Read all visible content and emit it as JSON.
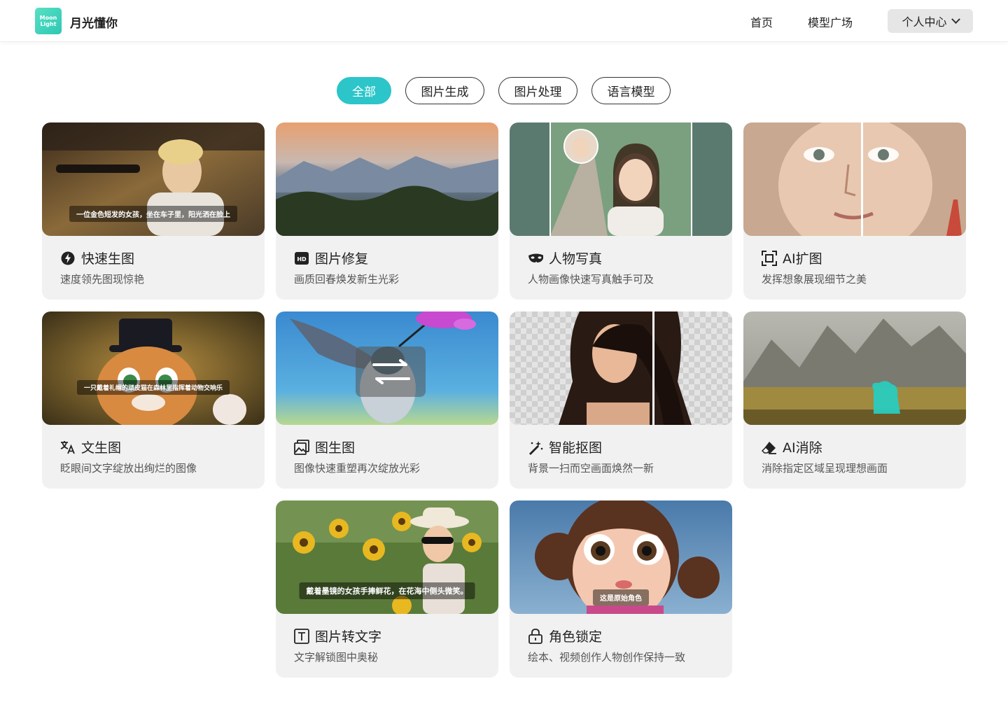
{
  "header": {
    "logo_line1": "Moon",
    "logo_line2": "Light",
    "brand": "月光懂你",
    "nav": [
      "首页",
      "模型广场"
    ],
    "user_menu": "个人中心"
  },
  "filters": [
    {
      "label": "全部",
      "active": true
    },
    {
      "label": "图片生成",
      "active": false
    },
    {
      "label": "图片处理",
      "active": false
    },
    {
      "label": "语言模型",
      "active": false
    }
  ],
  "cards": [
    {
      "title": "快速生图",
      "subtitle": "速度领先图现惊艳",
      "icon": "lightning-icon",
      "caption": "一位金色短发的女孩，坐在车子里，阳光洒在脸上"
    },
    {
      "title": "图片修复",
      "subtitle": "画质回春焕发新生光彩",
      "icon": "hd-icon",
      "badge": "HD"
    },
    {
      "title": "人物写真",
      "subtitle": "人物画像快速写真触手可及",
      "icon": "mask-icon"
    },
    {
      "title": "AI扩图",
      "subtitle": "发挥想象展现细节之美",
      "icon": "expand-frame-icon"
    },
    {
      "title": "文生图",
      "subtitle": "眨眼间文字绽放出绚烂的图像",
      "icon": "translate-icon",
      "caption": "一只戴着礼帽的顽皮猫在森林里指挥着动物交响乐"
    },
    {
      "title": "图生图",
      "subtitle": "图像快速重塑再次绽放光彩",
      "icon": "image-stack-icon"
    },
    {
      "title": "智能抠图",
      "subtitle": "背景一扫而空画面焕然一新",
      "icon": "magic-wand-icon"
    },
    {
      "title": "AI消除",
      "subtitle": "消除指定区域呈现理想画面",
      "icon": "eraser-icon"
    },
    {
      "title": "图片转文字",
      "subtitle": "文字解锁图中奥秘",
      "icon": "text-box-icon",
      "caption": "戴着墨镜的女孩手捧鲜花，在花海中侧头微笑。"
    },
    {
      "title": "角色锁定",
      "subtitle": "绘本、视频创作人物创作保持一致",
      "icon": "lock-icon",
      "caption": "这是原始角色"
    }
  ],
  "colors": {
    "accent": "#2cc5c9",
    "card_bg": "#f1f1f1"
  }
}
